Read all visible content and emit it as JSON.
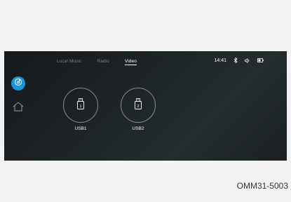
{
  "tabs": [
    {
      "label": "Local Music",
      "active": false
    },
    {
      "label": "Radio",
      "active": false
    },
    {
      "label": "Video",
      "active": true
    }
  ],
  "status": {
    "time": "14:41",
    "icons": [
      "bluetooth-icon",
      "volume-icon",
      "battery-icon"
    ]
  },
  "sidebar": {
    "items": [
      {
        "icon": "media-source-icon",
        "active": true
      },
      {
        "icon": "home-icon",
        "active": false
      }
    ]
  },
  "devices": [
    {
      "label": "USB1",
      "badge": "1",
      "icon": "usb-drive-icon"
    },
    {
      "label": "USB2",
      "badge": "2",
      "icon": "usb-drive-icon"
    }
  ],
  "figure_code": "OMM31-5003",
  "colors": {
    "accent": "#1d94d6",
    "screen_background": "#1e2529",
    "page_background": "#f2f2f2"
  }
}
